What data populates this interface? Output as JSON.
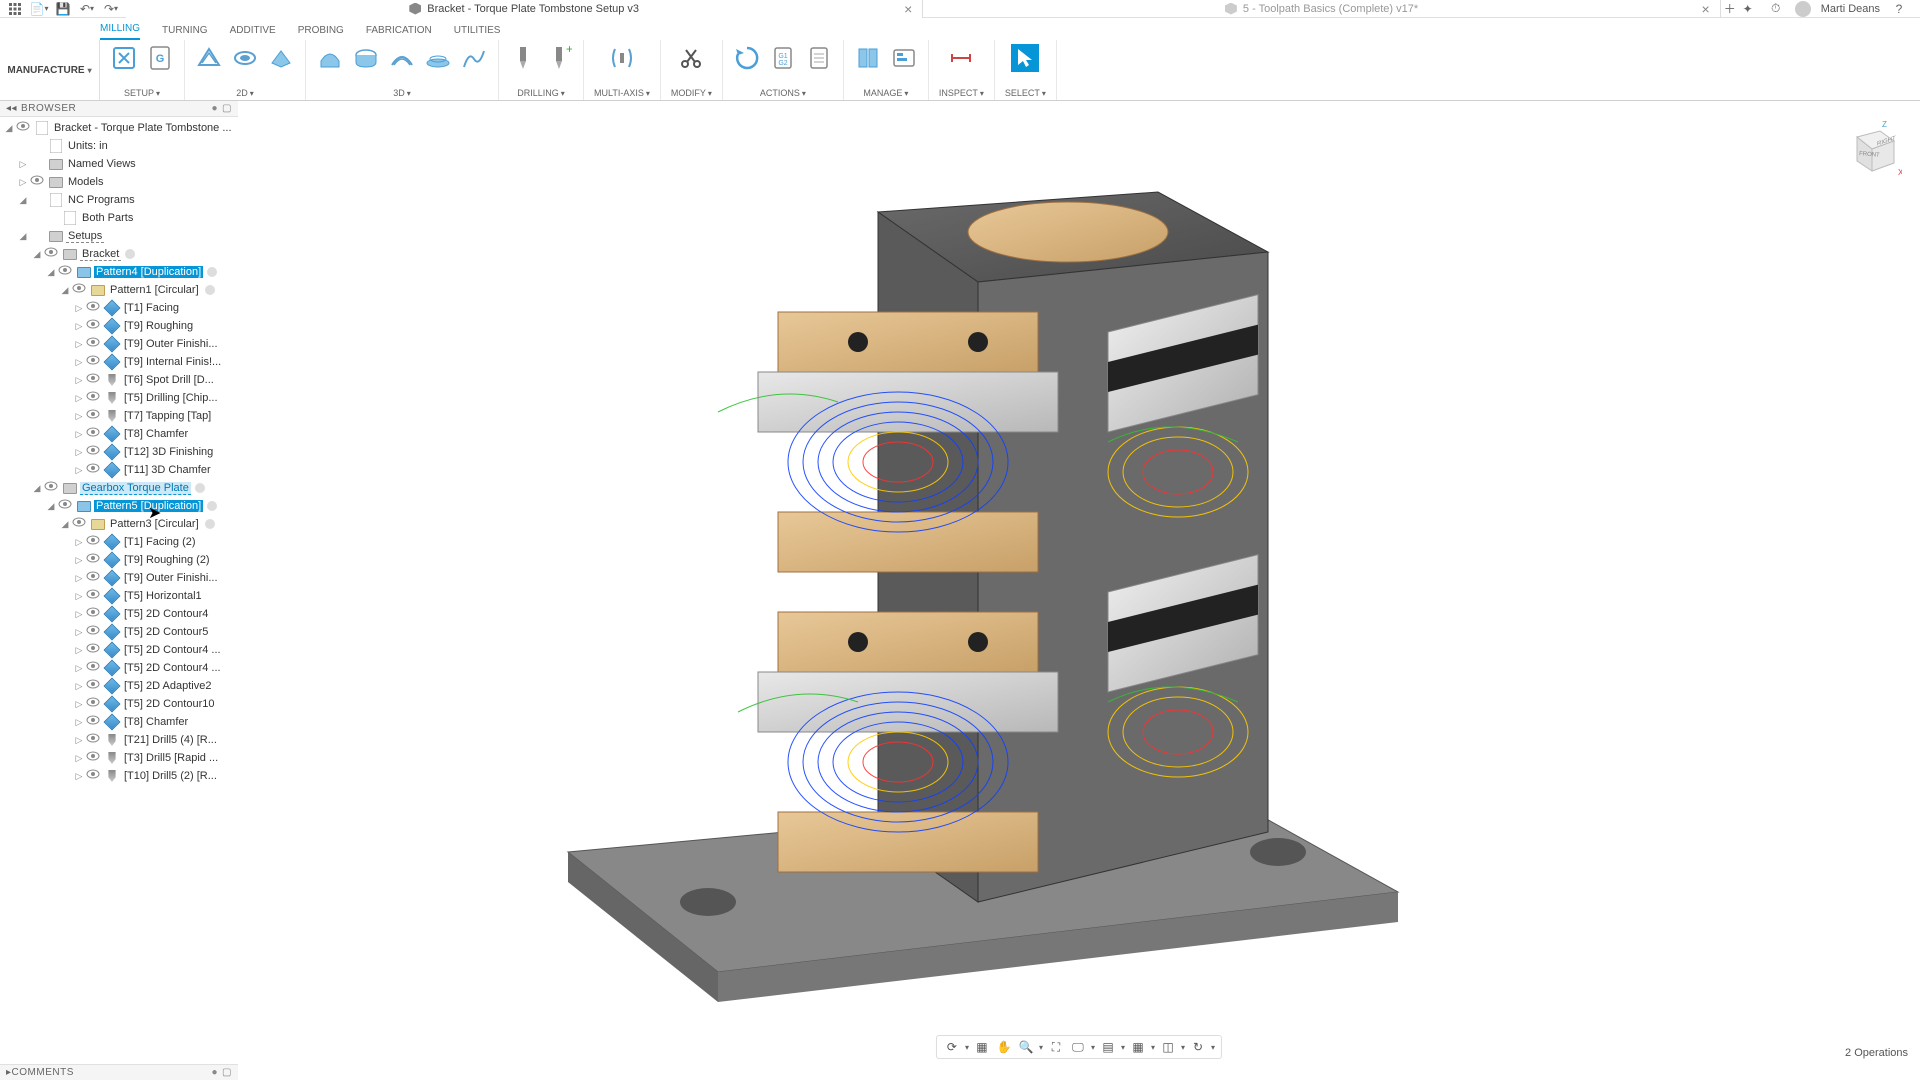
{
  "user": "Marti Deans",
  "tabs": {
    "active_title": "Bracket - Torque Plate Tombstone Setup v3",
    "inactive_title": "5 - Toolpath Basics (Complete) v17*"
  },
  "workspace": "MANUFACTURE",
  "ribbon_tabs": [
    "MILLING",
    "TURNING",
    "ADDITIVE",
    "PROBING",
    "FABRICATION",
    "UTILITIES"
  ],
  "ribbon_groups": {
    "setup": "SETUP",
    "g2d": "2D",
    "g3d": "3D",
    "drilling": "DRILLING",
    "multiaxis": "MULTI-AXIS",
    "modify": "MODIFY",
    "actions": "ACTIONS",
    "manage": "MANAGE",
    "inspect": "INSPECT",
    "select": "SELECT"
  },
  "panels": {
    "browser": "BROWSER",
    "comments": "COMMENTS"
  },
  "tree": {
    "root": "Bracket - Torque Plate Tombstone ...",
    "units": "Units: in",
    "named_views": "Named Views",
    "models": "Models",
    "nc_programs": "NC Programs",
    "both_parts": "Both Parts",
    "setups": "Setups",
    "bracket": "Bracket",
    "pattern4": "Pattern4 [Duplication]",
    "pattern1": "Pattern1 [Circular]",
    "ops_a": [
      "[T1] Facing",
      "[T9] Roughing",
      "[T9] Outer Finishi...",
      "[T9] Internal Finis!...",
      "[T6] Spot Drill [D...",
      "[T5] Drilling [Chip...",
      "[T7] Tapping [Tap]",
      "[T8] Chamfer",
      "[T12] 3D Finishing",
      "[T11] 3D Chamfer"
    ],
    "gearbox": "Gearbox Torque Plate",
    "pattern5": "Pattern5 [Duplication]",
    "pattern3": "Pattern3 [Circular]",
    "ops_b": [
      "[T1] Facing (2)",
      "[T9] Roughing (2)",
      "[T9] Outer Finishi...",
      "[T5] Horizontal1",
      "[T5] 2D Contour4",
      "[T5] 2D Contour5",
      "[T5] 2D Contour4 ...",
      "[T5] 2D Contour4 ...",
      "[T5] 2D Adaptive2",
      "[T5] 2D Contour10",
      "[T8] Chamfer",
      "[T21] Drill5 (4) [R...",
      "[T3] Drill5 [Rapid ...",
      "[T10] Drill5 (2) [R..."
    ]
  },
  "status": "2 Operations",
  "viewcube": {
    "front": "FRONT",
    "right": "RIGHT",
    "z": "Z",
    "x": "X"
  }
}
